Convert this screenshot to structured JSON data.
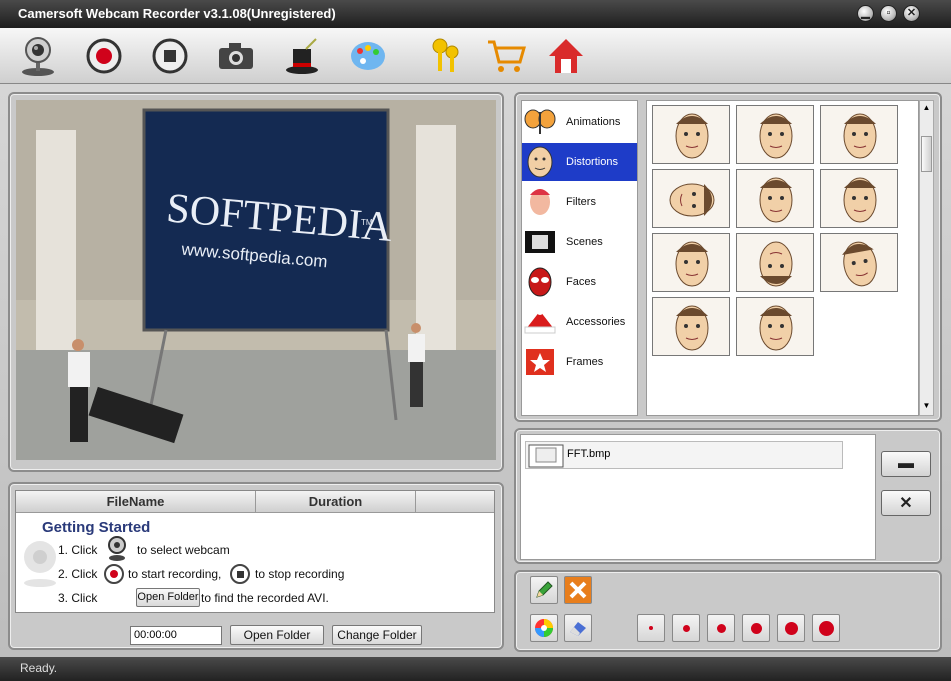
{
  "window": {
    "title": "Camersoft Webcam Recorder v3.1.08(Unregistered)"
  },
  "toolbar": {
    "items": [
      {
        "icon": "webcam-icon"
      },
      {
        "icon": "record-icon"
      },
      {
        "icon": "stop-icon"
      },
      {
        "icon": "camera-icon"
      },
      {
        "icon": "magic-hat-icon"
      },
      {
        "icon": "palette-icon"
      },
      {
        "icon": "keys-icon"
      },
      {
        "icon": "cart-icon"
      },
      {
        "icon": "home-icon"
      }
    ]
  },
  "preview": {
    "watermark_main": "SOFTPEDIA",
    "watermark_sub": "www.softpedia.com",
    "trademark": "TM"
  },
  "file_list": {
    "columns": [
      "FileName",
      "Duration"
    ],
    "getting_started": {
      "title": "Getting  Started",
      "step1_pre": "1. Click",
      "step1_post": "to select webcam",
      "step2_pre": "2. Click",
      "step2_mid": "to start recording,",
      "step2_post": "to stop recording",
      "step3_pre": "3. Click",
      "step3_button": "Open Folder",
      "step3_post": "to find the recorded AVI."
    }
  },
  "bottom_controls": {
    "time_value": "00:00:00",
    "open_folder": "Open Folder",
    "change_folder": "Change Folder"
  },
  "effects": {
    "categories": [
      {
        "label": "Animations",
        "icon": "butterfly-icon"
      },
      {
        "label": "Distortions",
        "icon": "face-distort-icon",
        "selected": true
      },
      {
        "label": "Filters",
        "icon": "face-filter-icon"
      },
      {
        "label": "Scenes",
        "icon": "film-icon"
      },
      {
        "label": "Faces",
        "icon": "spider-mask-icon"
      },
      {
        "label": "Accessories",
        "icon": "santa-hat-icon"
      },
      {
        "label": "Frames",
        "icon": "star-frame-icon"
      }
    ],
    "thumbnail_count": 11
  },
  "overlay": {
    "file": "FFT.bmp",
    "remove_label": "▬",
    "close_label": "✕"
  },
  "status": {
    "text": "Ready."
  },
  "colors": {
    "accent_blue": "#1e3cc8",
    "record_red": "#d0021b",
    "title_text": "#2a3a7a"
  }
}
